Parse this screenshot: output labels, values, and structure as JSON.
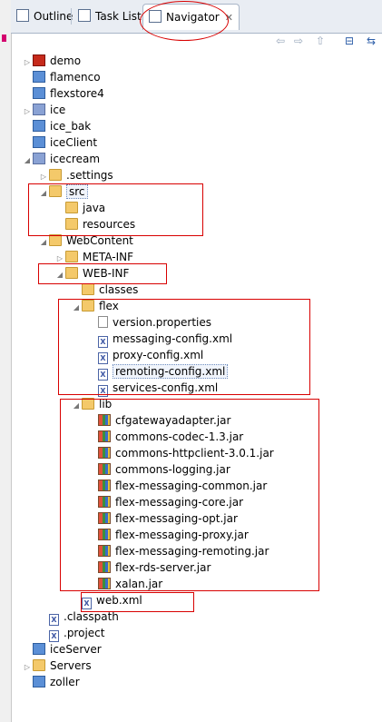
{
  "tabs": [
    {
      "label": "Outline",
      "icon": "outline-icon"
    },
    {
      "label": "Task List",
      "icon": "task-list-icon"
    },
    {
      "label": "Navigator",
      "icon": "navigator-icon",
      "close": "✕"
    }
  ],
  "toolbar": {
    "back": "⇦",
    "forward": "⇨",
    "up": "⇧",
    "collapse": "⊟",
    "link": "⇆"
  },
  "tree": [
    {
      "label": "demo",
      "icon": "flex-project-icon",
      "twisty": "▷"
    },
    {
      "label": "flamenco",
      "icon": "project-icon"
    },
    {
      "label": "flexstore4",
      "icon": "project-icon"
    },
    {
      "label": "ice",
      "icon": "java-project-icon",
      "twisty": "▷"
    },
    {
      "label": "ice_bak",
      "icon": "project-icon"
    },
    {
      "label": "iceClient",
      "icon": "project-icon"
    },
    {
      "label": "icecream",
      "icon": "java-project-icon",
      "twisty": "◢"
    },
    {
      "label": ".settings",
      "icon": "folder-icon",
      "twisty": "▷"
    },
    {
      "label": "src",
      "icon": "folder-icon",
      "twisty": "◢"
    },
    {
      "label": "java",
      "icon": "folder-icon"
    },
    {
      "label": "resources",
      "icon": "folder-icon"
    },
    {
      "label": "WebContent",
      "icon": "folder-icon",
      "twisty": "◢"
    },
    {
      "label": "META-INF",
      "icon": "folder-icon",
      "twisty": "▷"
    },
    {
      "label": "WEB-INF",
      "icon": "folder-icon",
      "twisty": "◢"
    },
    {
      "label": "classes",
      "icon": "folder-icon"
    },
    {
      "label": "flex",
      "icon": "folder-icon",
      "twisty": "◢"
    },
    {
      "label": "version.properties",
      "icon": "file-icon"
    },
    {
      "label": "messaging-config.xml",
      "icon": "xml-file-icon"
    },
    {
      "label": "proxy-config.xml",
      "icon": "xml-file-icon"
    },
    {
      "label": "remoting-config.xml",
      "icon": "xml-file-icon"
    },
    {
      "label": "services-config.xml",
      "icon": "xml-file-icon"
    },
    {
      "label": "lib",
      "icon": "folder-icon",
      "twisty": "◢"
    },
    {
      "label": "cfgatewayadapter.jar",
      "icon": "jar-icon"
    },
    {
      "label": "commons-codec-1.3.jar",
      "icon": "jar-icon"
    },
    {
      "label": "commons-httpclient-3.0.1.jar",
      "icon": "jar-icon"
    },
    {
      "label": "commons-logging.jar",
      "icon": "jar-icon"
    },
    {
      "label": "flex-messaging-common.jar",
      "icon": "jar-icon"
    },
    {
      "label": "flex-messaging-core.jar",
      "icon": "jar-icon"
    },
    {
      "label": "flex-messaging-opt.jar",
      "icon": "jar-icon"
    },
    {
      "label": "flex-messaging-proxy.jar",
      "icon": "jar-icon"
    },
    {
      "label": "flex-messaging-remoting.jar",
      "icon": "jar-icon"
    },
    {
      "label": "flex-rds-server.jar",
      "icon": "jar-icon"
    },
    {
      "label": "xalan.jar",
      "icon": "jar-icon"
    },
    {
      "label": "web.xml",
      "icon": "xml-file-icon"
    },
    {
      "label": ".classpath",
      "icon": "xml-file-icon"
    },
    {
      "label": ".project",
      "icon": "xml-file-icon"
    },
    {
      "label": "iceServer",
      "icon": "project-icon"
    },
    {
      "label": "Servers",
      "icon": "folder-icon",
      "twisty": "▷"
    },
    {
      "label": "zoller",
      "icon": "project-icon"
    }
  ],
  "colors": {
    "annotation": "#d80000",
    "selection": "#6f8dbf"
  }
}
